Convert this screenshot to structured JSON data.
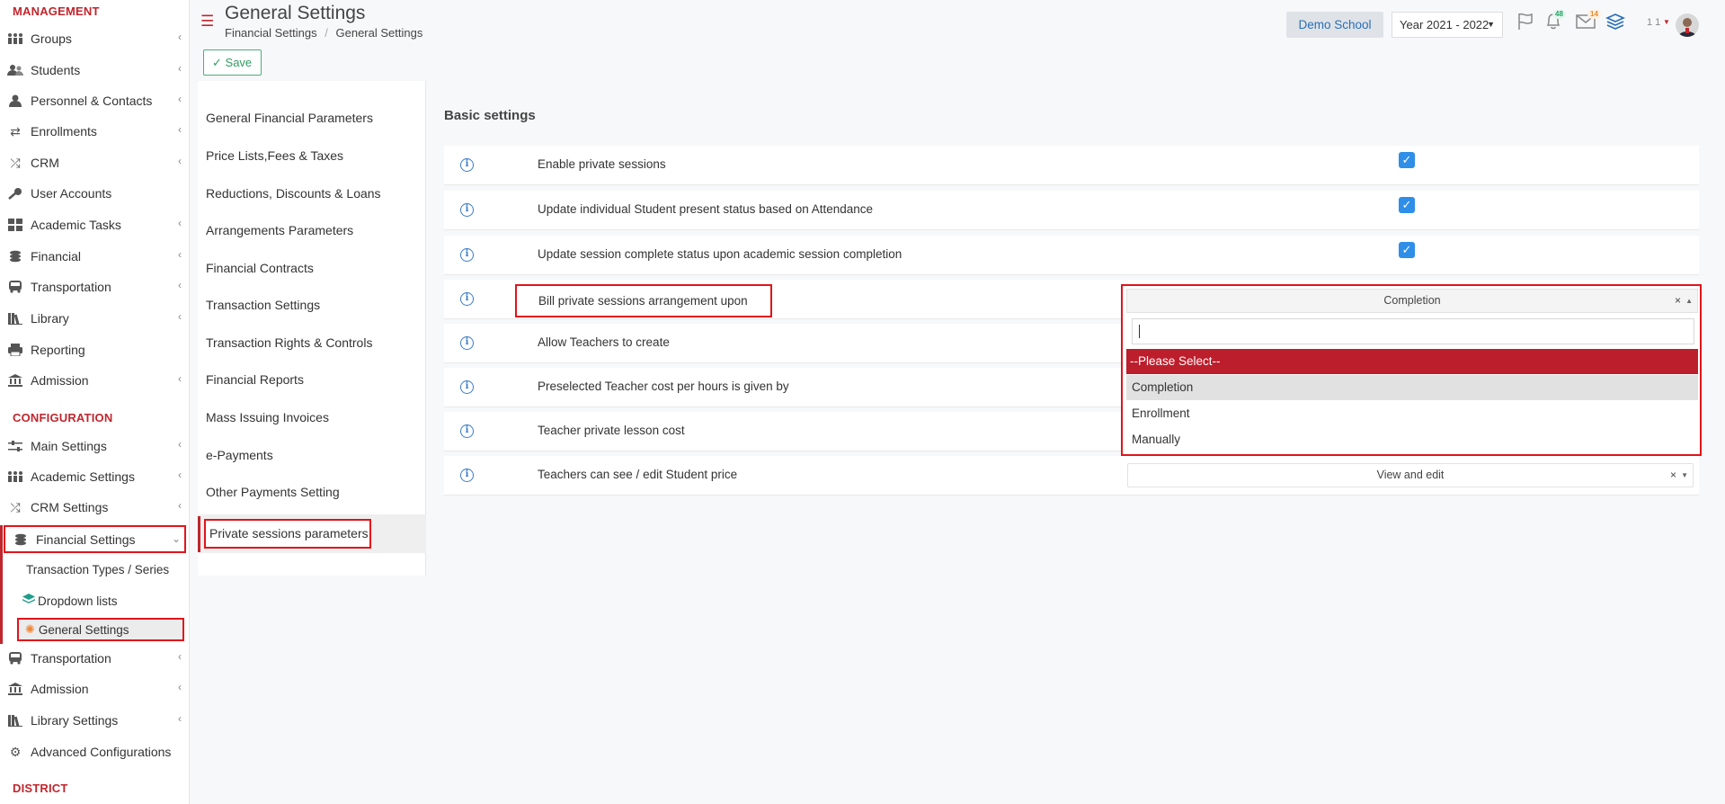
{
  "header": {
    "title": "General Settings",
    "breadcrumb": [
      "Financial Settings",
      "General Settings"
    ],
    "school": "Demo School",
    "year": "Year 2021 - 2022",
    "notifications_count": "48",
    "messages_count": "14",
    "user_label": "1 1"
  },
  "toolbar": {
    "save_label": "Save"
  },
  "sidebar": {
    "management_title": "MANAGEMENT",
    "management": [
      {
        "label": "Groups",
        "icon": "groups-icon"
      },
      {
        "label": "Students",
        "icon": "students-icon"
      },
      {
        "label": "Personnel & Contacts",
        "icon": "personnel-icon"
      },
      {
        "label": "Enrollments",
        "icon": "enrollments-icon"
      },
      {
        "label": "CRM",
        "icon": "crm-icon"
      },
      {
        "label": "User Accounts",
        "icon": "key-icon"
      },
      {
        "label": "Academic Tasks",
        "icon": "grid-icon"
      },
      {
        "label": "Financial",
        "icon": "coins-icon"
      },
      {
        "label": "Transportation",
        "icon": "bus-icon"
      },
      {
        "label": "Library",
        "icon": "library-icon"
      },
      {
        "label": "Reporting",
        "icon": "printer-icon"
      },
      {
        "label": "Admission",
        "icon": "bank-icon"
      }
    ],
    "configuration_title": "CONFIGURATION",
    "configuration": [
      {
        "label": "Main Settings",
        "icon": "sliders-icon"
      },
      {
        "label": "Academic Settings",
        "icon": "groups-icon"
      },
      {
        "label": "CRM Settings",
        "icon": "crm-icon"
      },
      {
        "label": "Financial Settings",
        "icon": "coins-icon"
      }
    ],
    "financial_sub": [
      {
        "label": "Transaction Types / Series"
      },
      {
        "label": "Dropdown lists"
      },
      {
        "label": "General Settings"
      }
    ],
    "configuration_after": [
      {
        "label": "Transportation",
        "icon": "bus-icon"
      },
      {
        "label": "Admission",
        "icon": "bank-icon"
      },
      {
        "label": "Library Settings",
        "icon": "library-icon"
      },
      {
        "label": "Advanced Configurations",
        "icon": "gears-icon"
      }
    ],
    "district_title": "DISTRICT"
  },
  "settings_menu": [
    "General Financial Parameters",
    "Price Lists,Fees & Taxes",
    "Reductions, Discounts & Loans",
    "Arrangements Parameters",
    "Financial Contracts",
    "Transaction Settings",
    "Transaction Rights & Controls",
    "Financial Reports",
    "Mass Issuing Invoices",
    "e-Payments",
    "Other Payments Setting",
    "Private sessions parameters"
  ],
  "content": {
    "section_title": "Basic settings",
    "rows": [
      {
        "label": "Enable private sessions"
      },
      {
        "label": "Update individual Student present status based on Attendance"
      },
      {
        "label": "Update session complete status upon academic session completion"
      },
      {
        "label": "Bill private sessions arrangement upon"
      },
      {
        "label": "Allow Teachers to create"
      },
      {
        "label": "Preselected Teacher cost per hours is given by"
      },
      {
        "label": "Teacher private lesson cost"
      },
      {
        "label": "Teachers can see / edit Student price"
      }
    ],
    "bill_select_value": "Completion",
    "bill_options": [
      "--Please Select--",
      "Completion",
      "Enrollment",
      "Manually"
    ],
    "teacher_price_value": "View and edit",
    "info_glyph": "i",
    "check_glyph": "✓",
    "clear_glyph": "×"
  },
  "colors": {
    "accent_red": "#c0262d",
    "highlight_red": "#e1141b",
    "check_blue": "#2e8ee8"
  }
}
